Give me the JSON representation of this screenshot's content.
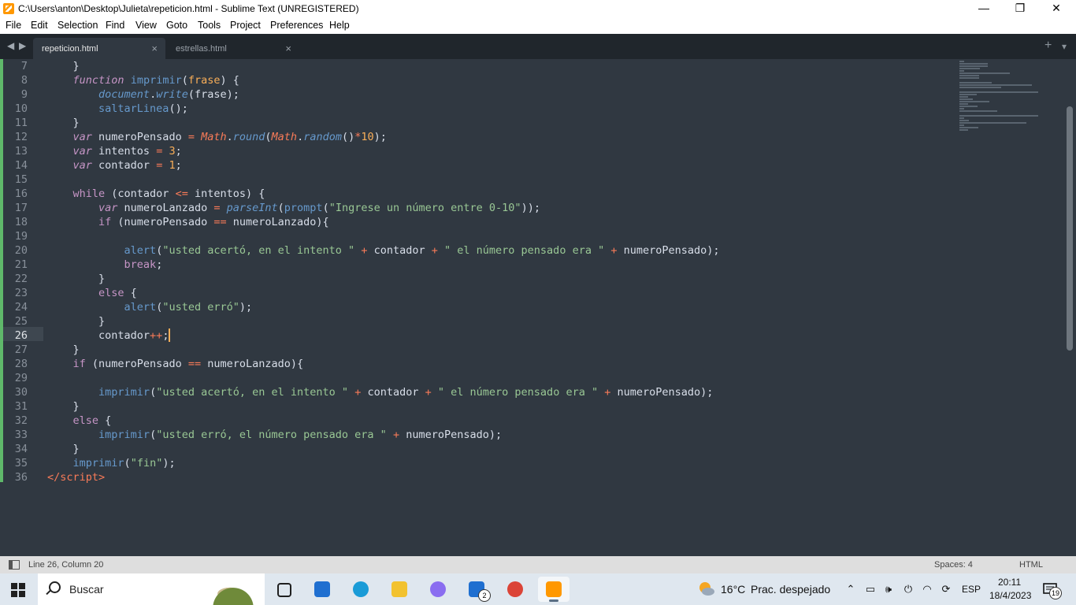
{
  "window": {
    "title": "C:\\Users\\anton\\Desktop\\Julieta\\repeticion.html - Sublime Text (UNREGISTERED)",
    "controls": {
      "minimize": "—",
      "maximize": "❐",
      "close": "✕"
    }
  },
  "menu": [
    "File",
    "Edit",
    "Selection",
    "Find",
    "View",
    "Goto",
    "Tools",
    "Project",
    "Preferences",
    "Help"
  ],
  "tabbar": {
    "nav_left": "◀",
    "nav_right": "▶",
    "tabs": [
      {
        "label": "repeticion.html",
        "close": "×",
        "active": true
      },
      {
        "label": "estrellas.html",
        "close": "×",
        "active": false
      }
    ],
    "new_tab": "+",
    "overflow": "▾"
  },
  "editor": {
    "current_line": 26,
    "lines": [
      {
        "n": "7",
        "tokens": [
          [
            "",
            "    }"
          ]
        ]
      },
      {
        "n": "8",
        "tokens": [
          [
            "",
            "    "
          ],
          [
            "st",
            "function"
          ],
          [
            "",
            " "
          ],
          [
            "fn",
            "imprimir"
          ],
          [
            "",
            "("
          ],
          [
            "pa",
            "frase"
          ],
          [
            "",
            ") {"
          ]
        ]
      },
      {
        "n": "9",
        "tokens": [
          [
            "",
            "        "
          ],
          [
            "fi",
            "document"
          ],
          [
            "",
            "."
          ],
          [
            "fi",
            "write"
          ],
          [
            "",
            "(frase);"
          ]
        ]
      },
      {
        "n": "10",
        "tokens": [
          [
            "",
            "        "
          ],
          [
            "fn",
            "saltarLinea"
          ],
          [
            "",
            "();"
          ]
        ]
      },
      {
        "n": "11",
        "tokens": [
          [
            "",
            "    }"
          ]
        ]
      },
      {
        "n": "12",
        "tokens": [
          [
            "",
            "    "
          ],
          [
            "st",
            "var"
          ],
          [
            "",
            " numeroPensado "
          ],
          [
            "op",
            "="
          ],
          [
            "",
            " "
          ],
          [
            "cl",
            "Math"
          ],
          [
            "",
            "."
          ],
          [
            "fi",
            "round"
          ],
          [
            "",
            "("
          ],
          [
            "cl",
            "Math"
          ],
          [
            "",
            "."
          ],
          [
            "fi",
            "random"
          ],
          [
            "",
            "()"
          ],
          [
            "op",
            "*"
          ],
          [
            "nu",
            "10"
          ],
          [
            "",
            ");"
          ]
        ]
      },
      {
        "n": "13",
        "tokens": [
          [
            "",
            "    "
          ],
          [
            "st",
            "var"
          ],
          [
            "",
            " intentos "
          ],
          [
            "op",
            "="
          ],
          [
            "",
            " "
          ],
          [
            "nu",
            "3"
          ],
          [
            "",
            ";"
          ]
        ]
      },
      {
        "n": "14",
        "tokens": [
          [
            "",
            "    "
          ],
          [
            "st",
            "var"
          ],
          [
            "",
            " contador "
          ],
          [
            "op",
            "="
          ],
          [
            "",
            " "
          ],
          [
            "nu",
            "1"
          ],
          [
            "",
            ";"
          ]
        ]
      },
      {
        "n": "15",
        "tokens": [
          [
            "",
            ""
          ]
        ]
      },
      {
        "n": "16",
        "tokens": [
          [
            "",
            "    "
          ],
          [
            "kw",
            "while"
          ],
          [
            "",
            " (contador "
          ],
          [
            "op",
            "<="
          ],
          [
            "",
            " intentos) {"
          ]
        ]
      },
      {
        "n": "17",
        "tokens": [
          [
            "",
            "        "
          ],
          [
            "st",
            "var"
          ],
          [
            "",
            " numeroLanzado "
          ],
          [
            "op",
            "="
          ],
          [
            "",
            " "
          ],
          [
            "fi",
            "parseInt"
          ],
          [
            "",
            "("
          ],
          [
            "fn",
            "prompt"
          ],
          [
            "",
            "("
          ],
          [
            "str",
            "\"Ingrese un número entre 0-10\""
          ],
          [
            "",
            "));"
          ]
        ]
      },
      {
        "n": "18",
        "tokens": [
          [
            "",
            "        "
          ],
          [
            "kw",
            "if"
          ],
          [
            "",
            " (numeroPensado "
          ],
          [
            "op",
            "=="
          ],
          [
            "",
            " numeroLanzado){"
          ]
        ]
      },
      {
        "n": "19",
        "tokens": [
          [
            "",
            ""
          ]
        ]
      },
      {
        "n": "20",
        "tokens": [
          [
            "",
            "            "
          ],
          [
            "fn",
            "alert"
          ],
          [
            "",
            "("
          ],
          [
            "str",
            "\"usted acertó, en el intento \""
          ],
          [
            "",
            " "
          ],
          [
            "op",
            "+"
          ],
          [
            "",
            " contador "
          ],
          [
            "op",
            "+"
          ],
          [
            "",
            " "
          ],
          [
            "str",
            "\" el número pensado era \""
          ],
          [
            "",
            " "
          ],
          [
            "op",
            "+"
          ],
          [
            "",
            " numeroPensado);"
          ]
        ]
      },
      {
        "n": "21",
        "tokens": [
          [
            "",
            "            "
          ],
          [
            "kw",
            "break"
          ],
          [
            "",
            ";"
          ]
        ]
      },
      {
        "n": "22",
        "tokens": [
          [
            "",
            "        }"
          ]
        ]
      },
      {
        "n": "23",
        "tokens": [
          [
            "",
            "        "
          ],
          [
            "kw",
            "else"
          ],
          [
            "",
            " {"
          ]
        ]
      },
      {
        "n": "24",
        "tokens": [
          [
            "",
            "            "
          ],
          [
            "fn",
            "alert"
          ],
          [
            "",
            "("
          ],
          [
            "str",
            "\"usted erró\""
          ],
          [
            "",
            ");"
          ]
        ]
      },
      {
        "n": "25",
        "tokens": [
          [
            "",
            "        }"
          ]
        ]
      },
      {
        "n": "26",
        "tokens": [
          [
            "",
            "        contador"
          ],
          [
            "op",
            "++"
          ],
          [
            "",
            ";"
          ]
        ]
      },
      {
        "n": "27",
        "tokens": [
          [
            "",
            "    }"
          ]
        ]
      },
      {
        "n": "28",
        "tokens": [
          [
            "",
            "    "
          ],
          [
            "kw",
            "if"
          ],
          [
            "",
            " (numeroPensado "
          ],
          [
            "op",
            "=="
          ],
          [
            "",
            " numeroLanzado){"
          ]
        ]
      },
      {
        "n": "29",
        "tokens": [
          [
            "",
            ""
          ]
        ]
      },
      {
        "n": "30",
        "tokens": [
          [
            "",
            "        "
          ],
          [
            "fn",
            "imprimir"
          ],
          [
            "",
            "("
          ],
          [
            "str",
            "\"usted acertó, en el intento \""
          ],
          [
            "",
            " "
          ],
          [
            "op",
            "+"
          ],
          [
            "",
            " contador "
          ],
          [
            "op",
            "+"
          ],
          [
            "",
            " "
          ],
          [
            "str",
            "\" el número pensado era \""
          ],
          [
            "",
            " "
          ],
          [
            "op",
            "+"
          ],
          [
            "",
            " numeroPensado);"
          ]
        ]
      },
      {
        "n": "31",
        "tokens": [
          [
            "",
            "    }"
          ]
        ]
      },
      {
        "n": "32",
        "tokens": [
          [
            "",
            "    "
          ],
          [
            "kw",
            "else"
          ],
          [
            "",
            " {"
          ]
        ]
      },
      {
        "n": "33",
        "tokens": [
          [
            "",
            "        "
          ],
          [
            "fn",
            "imprimir"
          ],
          [
            "",
            "("
          ],
          [
            "str",
            "\"usted erró, el número pensado era \""
          ],
          [
            "",
            " "
          ],
          [
            "op",
            "+"
          ],
          [
            "",
            " numeroPensado);"
          ]
        ]
      },
      {
        "n": "34",
        "tokens": [
          [
            "",
            "    }"
          ]
        ]
      },
      {
        "n": "35",
        "tokens": [
          [
            "",
            "    "
          ],
          [
            "fn",
            "imprimir"
          ],
          [
            "",
            "("
          ],
          [
            "str",
            "\"fin\""
          ],
          [
            "",
            ");"
          ]
        ]
      },
      {
        "n": "36",
        "tokens": [
          [
            "tag",
            "</"
          ],
          [
            "tag",
            "script"
          ],
          [
            "tag",
            ">"
          ]
        ]
      }
    ]
  },
  "statusbar": {
    "position": "Line 26, Column 20",
    "indentation": "Spaces: 4",
    "syntax": "HTML"
  },
  "taskbar": {
    "search_label": "Buscar",
    "apps": [
      {
        "name": "task-view",
        "color": "#202020"
      },
      {
        "name": "microsoft-store",
        "color": "#1f6fd0"
      },
      {
        "name": "edge",
        "color": "#1a9bd7"
      },
      {
        "name": "file-explorer",
        "color": "#f2c230"
      },
      {
        "name": "copilot",
        "color": "#8a6df0"
      },
      {
        "name": "mail",
        "color": "#1f6fd0",
        "badge": "2"
      },
      {
        "name": "chrome",
        "color": "#db4437"
      },
      {
        "name": "sublime-text",
        "color": "#ff9800",
        "active": true
      }
    ],
    "weather": {
      "temp": "16°C",
      "desc": "Prac. despejado"
    },
    "language": "ESP",
    "time": "20:11",
    "date": "18/4/2023",
    "notifications": "19"
  }
}
